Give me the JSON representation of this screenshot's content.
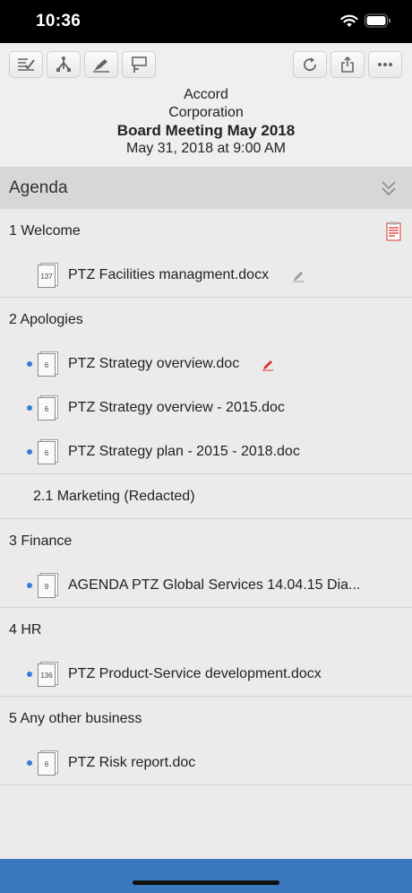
{
  "status_bar": {
    "time": "10:36"
  },
  "header": {
    "org_line1": "Accord",
    "org_line2": "Corporation",
    "meeting_title": "Board Meeting May 2018",
    "meeting_datetime": "May 31, 2018 at 9:00 AM"
  },
  "agenda": {
    "label": "Agenda"
  },
  "items": [
    {
      "title": "1 Welcome"
    },
    {
      "title": "2 Apologies"
    },
    {
      "title": "3 Finance"
    },
    {
      "title": "4 HR"
    },
    {
      "title": "5 Any other business"
    }
  ],
  "subitems": [
    {
      "title": "2.1 Marketing (Redacted)"
    }
  ],
  "documents": [
    {
      "name": "PTZ Facilities managment.docx",
      "pages": "137"
    },
    {
      "name": "PTZ Strategy overview.doc",
      "pages": "6"
    },
    {
      "name": "PTZ Strategy overview - 2015.doc",
      "pages": "6"
    },
    {
      "name": "PTZ Strategy plan - 2015 - 2018.doc",
      "pages": "6"
    },
    {
      "name": "AGENDA PTZ Global Services 14.04.15 Dia...",
      "pages": "9"
    },
    {
      "name": "PTZ Product-Service development.docx",
      "pages": "136"
    },
    {
      "name": "PTZ Risk report.doc",
      "pages": "6"
    }
  ],
  "colors": {
    "accent": "#3a78bf",
    "unread_dot": "#3a7bd5",
    "annotation_red": "#d9342b"
  }
}
